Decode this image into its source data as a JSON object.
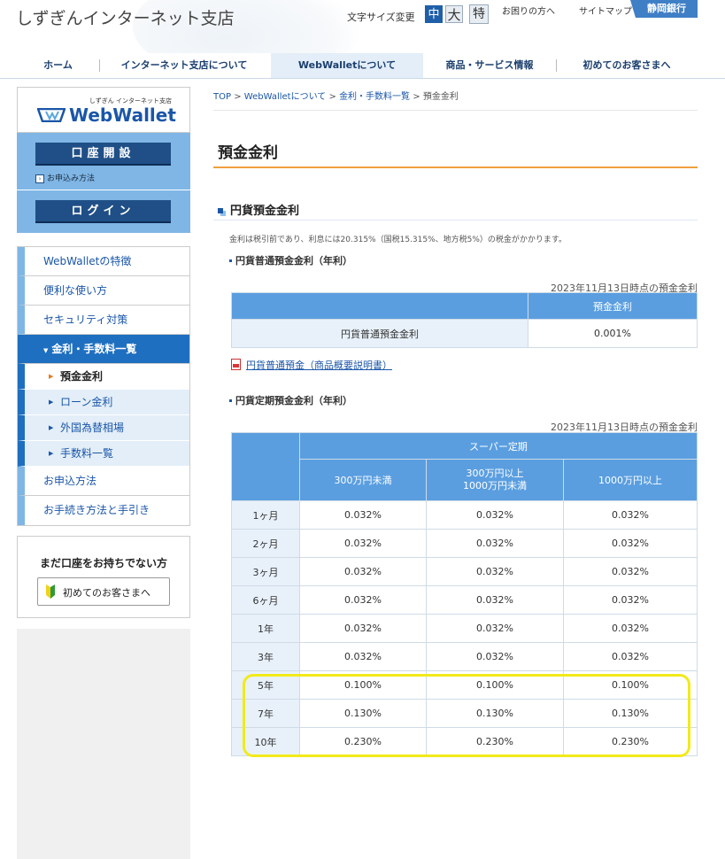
{
  "header": {
    "site_title": "しずぎんインターネット支店",
    "font_size_label": "文字サイズ変更",
    "font_sizes": [
      "中",
      "大",
      "特"
    ],
    "help_link": "お困りの方へ",
    "sitemap_link": "サイトマップ",
    "bank_name": "静岡銀行"
  },
  "nav": {
    "items": [
      "ホーム",
      "インターネット支店について",
      "WebWalletについて",
      "商品・サービス情報",
      "初めてのお客さまへ"
    ],
    "active_index": 2
  },
  "sidebar": {
    "logo_small": "しずぎん インターネット支店",
    "logo_text": "WebWallet",
    "open_account": "口座開設",
    "how_to_apply_small": "お申込み方法",
    "login": "ログイン",
    "menu": [
      "WebWalletの特徴",
      "便利な使い方",
      "セキュリティ対策"
    ],
    "current_section": "金利・手数料一覧",
    "submenu": [
      "預金金利",
      "ローン金利",
      "外国為替相場",
      "手数料一覧"
    ],
    "menu_after": [
      "お申込方法",
      "お手続き方法と手引き"
    ],
    "promo_title": "まだ口座をお持ちでない方",
    "promo_button": "初めてのお客さまへ"
  },
  "breadcrumb": {
    "items": [
      "TOP",
      "WebWalletについて",
      "金利・手数料一覧"
    ],
    "current": "預金金利",
    "sep": ">"
  },
  "page": {
    "title": "預金金利",
    "section_title": "円貨預金金利",
    "note": "金利は税引前であり、利息には20.315%（国税15.315%、地方税5%）の税金がかかります。"
  },
  "ordinary": {
    "heading": "円貨普通預金金利（年利）",
    "as_of": "2023年11月13日時点の預金金利",
    "col_header": "預金金利",
    "row_label": "円貨普通預金金利",
    "rate": "0.001%",
    "pdf_link": "円貨普通預金（商品概要説明書）"
  },
  "time_deposit": {
    "heading": "円貨定期預金金利（年利）",
    "as_of": "2023年11月13日時点の預金金利",
    "group_header": "スーパー定期",
    "columns": [
      "300万円未満",
      "300万円以上\n1000万円未満",
      "1000万円以上"
    ],
    "rows": [
      {
        "term": "1ヶ月",
        "rates": [
          "0.032%",
          "0.032%",
          "0.032%"
        ]
      },
      {
        "term": "2ヶ月",
        "rates": [
          "0.032%",
          "0.032%",
          "0.032%"
        ]
      },
      {
        "term": "3ヶ月",
        "rates": [
          "0.032%",
          "0.032%",
          "0.032%"
        ]
      },
      {
        "term": "6ヶ月",
        "rates": [
          "0.032%",
          "0.032%",
          "0.032%"
        ]
      },
      {
        "term": "1年",
        "rates": [
          "0.032%",
          "0.032%",
          "0.032%"
        ]
      },
      {
        "term": "3年",
        "rates": [
          "0.032%",
          "0.032%",
          "0.032%"
        ]
      },
      {
        "term": "5年",
        "rates": [
          "0.100%",
          "0.100%",
          "0.100%"
        ]
      },
      {
        "term": "7年",
        "rates": [
          "0.130%",
          "0.130%",
          "0.130%"
        ]
      },
      {
        "term": "10年",
        "rates": [
          "0.230%",
          "0.230%",
          "0.230%"
        ]
      }
    ]
  },
  "colors": {
    "brand_blue": "#1a56a8",
    "table_header": "#5a9ee0",
    "highlight": "#f2ea1a",
    "accent_orange": "#f0a040"
  }
}
